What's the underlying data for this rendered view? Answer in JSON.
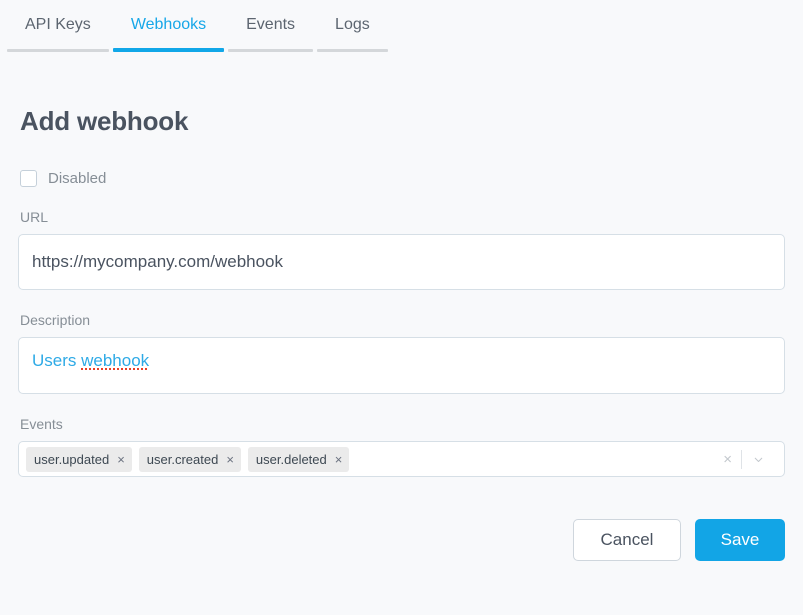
{
  "tabs": [
    {
      "label": "API Keys",
      "active": false
    },
    {
      "label": "Webhooks",
      "active": true
    },
    {
      "label": "Events",
      "active": false
    },
    {
      "label": "Logs",
      "active": false
    }
  ],
  "page": {
    "title": "Add webhook"
  },
  "disabled_checkbox": {
    "label": "Disabled",
    "checked": false
  },
  "url_field": {
    "label": "URL",
    "value": "https://mycompany.com/webhook"
  },
  "description_field": {
    "label": "Description",
    "value_prefix": "Users ",
    "value_misspelled": "webhook"
  },
  "events_field": {
    "label": "Events",
    "tags": [
      {
        "label": "user.updated",
        "remove": "×"
      },
      {
        "label": "user.created",
        "remove": "×"
      },
      {
        "label": "user.deleted",
        "remove": "×"
      }
    ],
    "clear_icon": "×"
  },
  "actions": {
    "cancel_label": "Cancel",
    "save_label": "Save"
  },
  "colors": {
    "accent": "#12a5e6",
    "page_background": "#f8f9fb",
    "text_primary": "#4a5360",
    "label": "#868e96",
    "tag_background": "#ebebeb",
    "spellcheck_underline": "#e8402a"
  }
}
